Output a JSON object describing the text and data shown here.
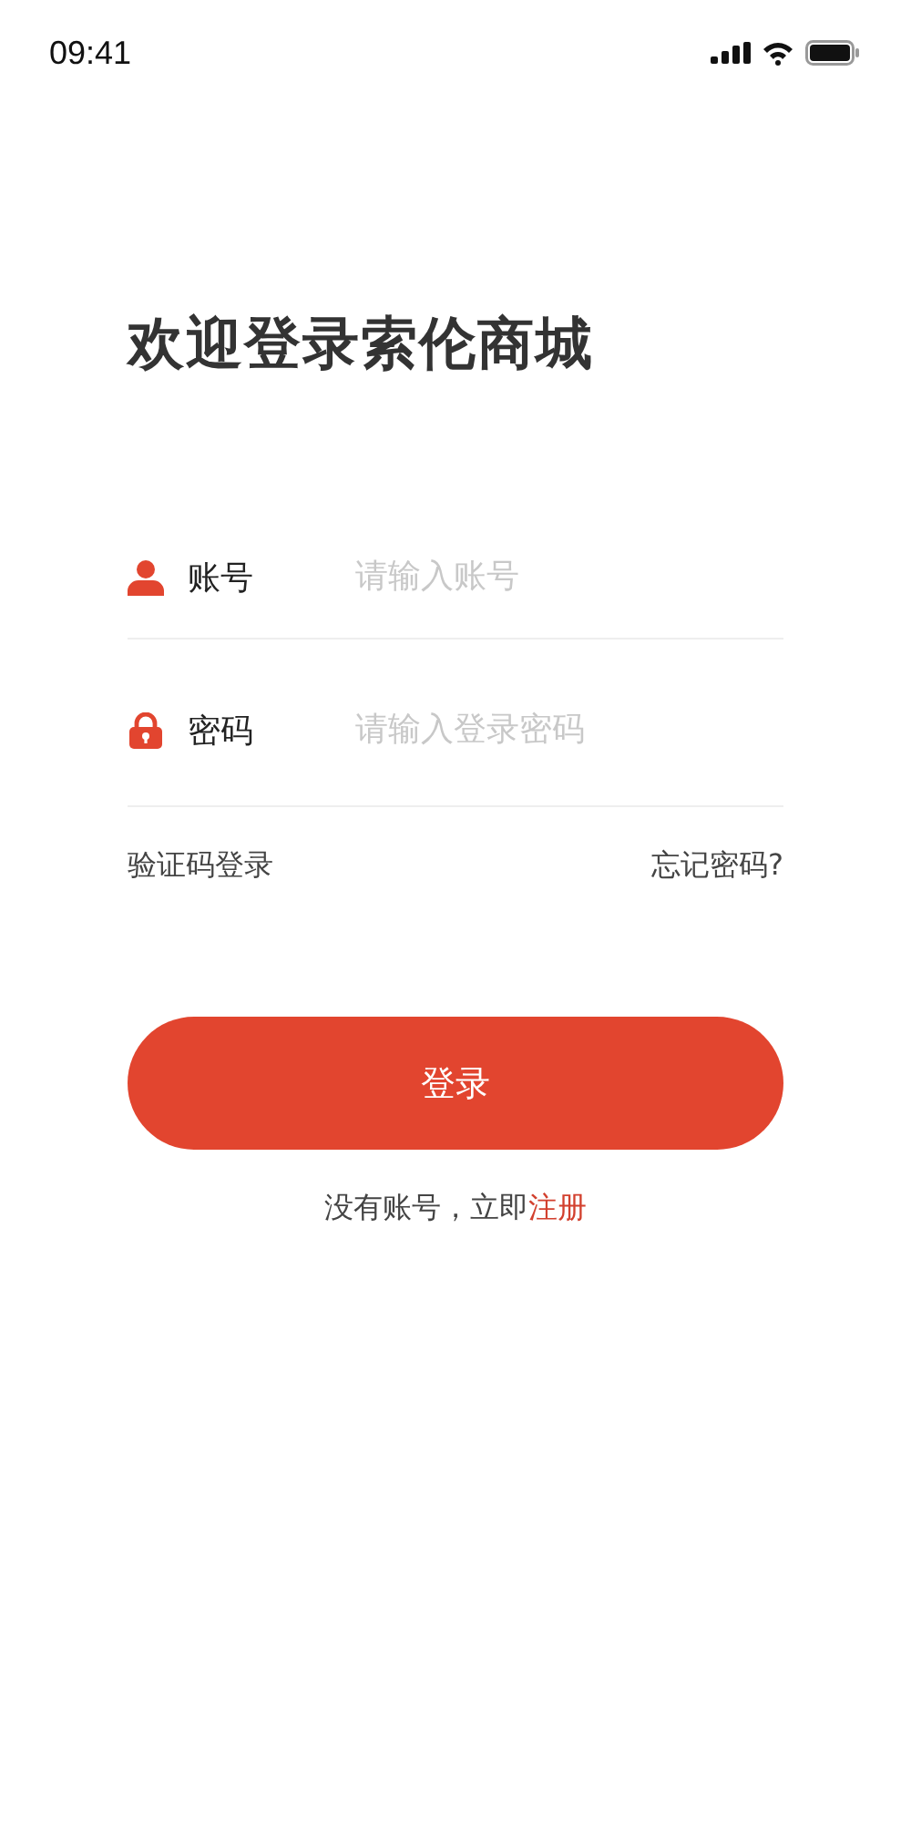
{
  "status_bar": {
    "time": "09:41"
  },
  "title": "欢迎登录索伦商城",
  "fields": [
    {
      "kind": "user",
      "label": "账号",
      "placeholder": "请输入账号"
    },
    {
      "kind": "lock",
      "label": "密码",
      "placeholder": "请输入登录密码"
    }
  ],
  "links": {
    "left": "验证码登录",
    "right": "忘记密码?"
  },
  "login_button": "登录",
  "signup": {
    "text": "没有账号，立即",
    "link": "注册"
  }
}
